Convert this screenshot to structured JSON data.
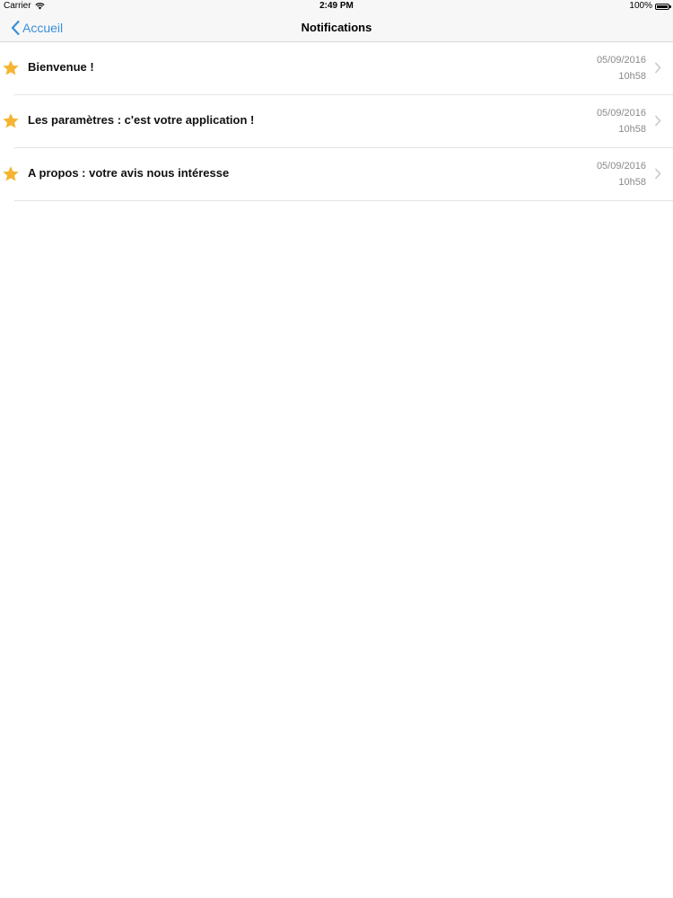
{
  "status_bar": {
    "carrier": "Carrier",
    "time": "2:49 PM",
    "battery": "100%"
  },
  "nav": {
    "back_label": "Accueil",
    "title": "Notifications"
  },
  "colors": {
    "accent": "#3a8fd8",
    "star": "#f5b532",
    "secondary_text": "#8a8a8a"
  },
  "notifications": [
    {
      "title": "Bienvenue !",
      "date": "05/09/2016",
      "time": "10h58",
      "icon": "star-icon"
    },
    {
      "title": "Les paramètres : c'est votre application !",
      "date": "05/09/2016",
      "time": "10h58",
      "icon": "star-icon"
    },
    {
      "title": "A propos : votre avis nous intéresse",
      "date": "05/09/2016",
      "time": "10h58",
      "icon": "star-icon"
    }
  ]
}
